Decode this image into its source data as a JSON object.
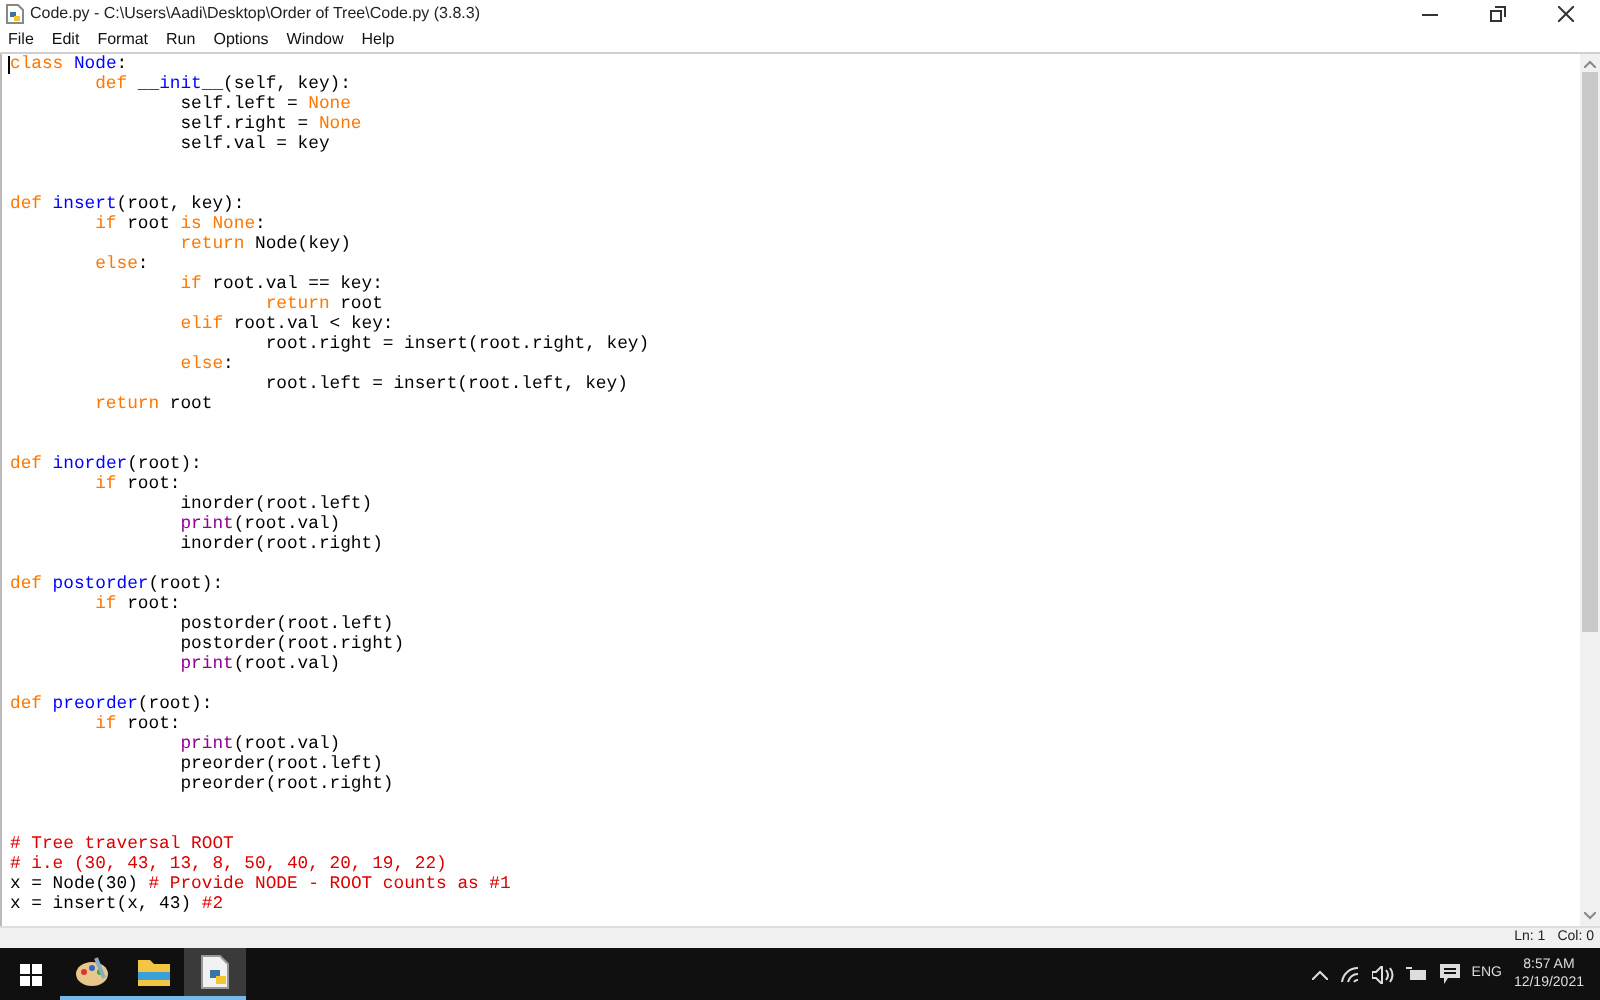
{
  "window": {
    "title": "Code.py - C:\\Users\\Aadi\\Desktop\\Order of Tree\\Code.py (3.8.3)"
  },
  "menu": [
    "File",
    "Edit",
    "Format",
    "Run",
    "Options",
    "Window",
    "Help"
  ],
  "editor": {
    "lines": [
      {
        "kind": "code",
        "tokens": [
          {
            "kind": "keyword",
            "text": "class"
          },
          {
            "kind": "defname",
            "text": " Node"
          },
          {
            "kind": "plain",
            "text": ":"
          }
        ]
      },
      {
        "kind": "code",
        "tokens": [
          {
            "kind": "keyword",
            "text": "        def"
          },
          {
            "kind": "defname",
            "text": " __init__"
          },
          {
            "kind": "plain",
            "text": "(self, key):"
          }
        ]
      },
      {
        "kind": "code",
        "tokens": [
          {
            "kind": "plain",
            "text": "                self.left = "
          },
          {
            "kind": "keyword",
            "text": "None"
          }
        ]
      },
      {
        "kind": "code",
        "tokens": [
          {
            "kind": "plain",
            "text": "                self.right = "
          },
          {
            "kind": "keyword",
            "text": "None"
          }
        ]
      },
      {
        "kind": "code",
        "tokens": [
          {
            "kind": "plain",
            "text": "                self.val = key"
          }
        ]
      },
      {
        "kind": "blank"
      },
      {
        "kind": "blank"
      },
      {
        "kind": "code",
        "tokens": [
          {
            "kind": "keyword",
            "text": "def"
          },
          {
            "kind": "defname",
            "text": " insert"
          },
          {
            "kind": "plain",
            "text": "(root, key):"
          }
        ]
      },
      {
        "kind": "code",
        "tokens": [
          {
            "kind": "keyword",
            "text": "        if"
          },
          {
            "kind": "plain",
            "text": " root "
          },
          {
            "kind": "keyword",
            "text": "is None"
          },
          {
            "kind": "plain",
            "text": ":"
          }
        ]
      },
      {
        "kind": "code",
        "tokens": [
          {
            "kind": "keyword",
            "text": "                return"
          },
          {
            "kind": "plain",
            "text": " Node(key)"
          }
        ]
      },
      {
        "kind": "code",
        "tokens": [
          {
            "kind": "keyword",
            "text": "        else"
          },
          {
            "kind": "plain",
            "text": ":"
          }
        ]
      },
      {
        "kind": "code",
        "tokens": [
          {
            "kind": "keyword",
            "text": "                if"
          },
          {
            "kind": "plain",
            "text": " root.val == key:"
          }
        ]
      },
      {
        "kind": "code",
        "tokens": [
          {
            "kind": "keyword",
            "text": "                        return"
          },
          {
            "kind": "plain",
            "text": " root"
          }
        ]
      },
      {
        "kind": "code",
        "tokens": [
          {
            "kind": "keyword",
            "text": "                elif"
          },
          {
            "kind": "plain",
            "text": " root.val < key:"
          }
        ]
      },
      {
        "kind": "code",
        "tokens": [
          {
            "kind": "plain",
            "text": "                        root.right = insert(root.right, key)"
          }
        ]
      },
      {
        "kind": "code",
        "tokens": [
          {
            "kind": "keyword",
            "text": "                else"
          },
          {
            "kind": "plain",
            "text": ":"
          }
        ]
      },
      {
        "kind": "code",
        "tokens": [
          {
            "kind": "plain",
            "text": "                        root.left = insert(root.left, key)"
          }
        ]
      },
      {
        "kind": "code",
        "tokens": [
          {
            "kind": "keyword",
            "text": "        return"
          },
          {
            "kind": "plain",
            "text": " root"
          }
        ]
      },
      {
        "kind": "blank"
      },
      {
        "kind": "blank"
      },
      {
        "kind": "code",
        "tokens": [
          {
            "kind": "keyword",
            "text": "def"
          },
          {
            "kind": "defname",
            "text": " inorder"
          },
          {
            "kind": "plain",
            "text": "(root):"
          }
        ]
      },
      {
        "kind": "code",
        "tokens": [
          {
            "kind": "keyword",
            "text": "        if"
          },
          {
            "kind": "plain",
            "text": " root:"
          }
        ]
      },
      {
        "kind": "code",
        "tokens": [
          {
            "kind": "plain",
            "text": "                inorder(root.left)"
          }
        ]
      },
      {
        "kind": "code",
        "tokens": [
          {
            "kind": "builtin",
            "text": "                print"
          },
          {
            "kind": "plain",
            "text": "(root.val)"
          }
        ]
      },
      {
        "kind": "code",
        "tokens": [
          {
            "kind": "plain",
            "text": "                inorder(root.right)"
          }
        ]
      },
      {
        "kind": "blank"
      },
      {
        "kind": "code",
        "tokens": [
          {
            "kind": "keyword",
            "text": "def"
          },
          {
            "kind": "defname",
            "text": " postorder"
          },
          {
            "kind": "plain",
            "text": "(root):"
          }
        ]
      },
      {
        "kind": "code",
        "tokens": [
          {
            "kind": "keyword",
            "text": "        if"
          },
          {
            "kind": "plain",
            "text": " root:"
          }
        ]
      },
      {
        "kind": "code",
        "tokens": [
          {
            "kind": "plain",
            "text": "                postorder(root.left)"
          }
        ]
      },
      {
        "kind": "code",
        "tokens": [
          {
            "kind": "plain",
            "text": "                postorder(root.right)"
          }
        ]
      },
      {
        "kind": "code",
        "tokens": [
          {
            "kind": "builtin",
            "text": "                print"
          },
          {
            "kind": "plain",
            "text": "(root.val)"
          }
        ]
      },
      {
        "kind": "blank"
      },
      {
        "kind": "code",
        "tokens": [
          {
            "kind": "keyword",
            "text": "def"
          },
          {
            "kind": "defname",
            "text": " preorder"
          },
          {
            "kind": "plain",
            "text": "(root):"
          }
        ]
      },
      {
        "kind": "code",
        "tokens": [
          {
            "kind": "keyword",
            "text": "        if"
          },
          {
            "kind": "plain",
            "text": " root:"
          }
        ]
      },
      {
        "kind": "code",
        "tokens": [
          {
            "kind": "builtin",
            "text": "                print"
          },
          {
            "kind": "plain",
            "text": "(root.val)"
          }
        ]
      },
      {
        "kind": "code",
        "tokens": [
          {
            "kind": "plain",
            "text": "                preorder(root.left)"
          }
        ]
      },
      {
        "kind": "code",
        "tokens": [
          {
            "kind": "plain",
            "text": "                preorder(root.right)"
          }
        ]
      },
      {
        "kind": "blank"
      },
      {
        "kind": "blank"
      },
      {
        "kind": "code",
        "tokens": [
          {
            "kind": "comment",
            "text": "# Tree traversal ROOT"
          }
        ]
      },
      {
        "kind": "code",
        "tokens": [
          {
            "kind": "comment",
            "text": "# i.e (30, 43, 13, 8, 50, 40, 20, 19, 22)"
          }
        ]
      },
      {
        "kind": "code",
        "tokens": [
          {
            "kind": "plain",
            "text": "x = Node(30) "
          },
          {
            "kind": "comment",
            "text": "# Provide NODE - ROOT counts as #1"
          }
        ]
      },
      {
        "kind": "code",
        "tokens": [
          {
            "kind": "plain",
            "text": "x = insert(x, 43) "
          },
          {
            "kind": "comment",
            "text": "#2"
          }
        ]
      }
    ]
  },
  "status_bar": {
    "line": "Ln: 1",
    "column": "Col: 0"
  },
  "taskbar": {
    "apps": [
      {
        "kind": "paint",
        "selected": false
      },
      {
        "kind": "folder",
        "selected": false
      },
      {
        "kind": "python-file",
        "selected": true
      }
    ],
    "tray": {
      "language": "ENG",
      "time": "8:57 AM",
      "date": "12/19/2021"
    }
  }
}
